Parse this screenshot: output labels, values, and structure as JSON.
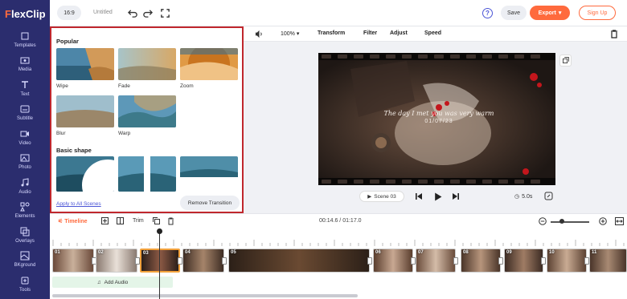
{
  "app": {
    "logo": "FlexClip",
    "logo_accent": "#ff6a3d"
  },
  "sidebar": {
    "items": [
      {
        "label": "Templates",
        "icon": "templates-icon"
      },
      {
        "label": "Media",
        "icon": "media-icon"
      },
      {
        "label": "Text",
        "icon": "text-icon"
      },
      {
        "label": "Subtitle",
        "icon": "subtitle-icon"
      },
      {
        "label": "Video",
        "icon": "video-icon"
      },
      {
        "label": "Photo",
        "icon": "photo-icon"
      },
      {
        "label": "Audio",
        "icon": "audio-icon"
      },
      {
        "label": "Elements",
        "icon": "elements-icon"
      },
      {
        "label": "Overlays",
        "icon": "overlays-icon"
      },
      {
        "label": "BKground",
        "icon": "bkground-icon"
      },
      {
        "label": "Tools",
        "icon": "tools-icon"
      }
    ]
  },
  "topbar": {
    "ratio": "16:9",
    "title": "Untitled",
    "save": "Save",
    "export": "Export",
    "signup": "Sign Up",
    "help": "?"
  },
  "panel": {
    "popular_title": "Popular",
    "popular": [
      "Wipe",
      "Fade",
      "Zoom",
      "Blur",
      "Warp"
    ],
    "basic_title": "Basic shape",
    "apply_all": "Apply to All Scenes",
    "remove": "Remove Transition"
  },
  "editbar": {
    "zoom": "100%",
    "transform": "Transform",
    "filter": "Filter",
    "adjust": "Adjust",
    "speed": "Speed"
  },
  "canvas": {
    "caption": "The day I met you was very warm",
    "date": "01/07/23",
    "scene": "Scene 03",
    "duration": "5.0s"
  },
  "timeline": {
    "tab": "Timeline",
    "trim": "Trim",
    "time": "00:14.6 / 01:17.0",
    "zoom_level": 0.3,
    "clips": [
      "01",
      "02",
      "03",
      "04",
      "05",
      "06",
      "07",
      "08",
      "09",
      "10",
      "11"
    ],
    "add_audio": "Add Audio"
  }
}
